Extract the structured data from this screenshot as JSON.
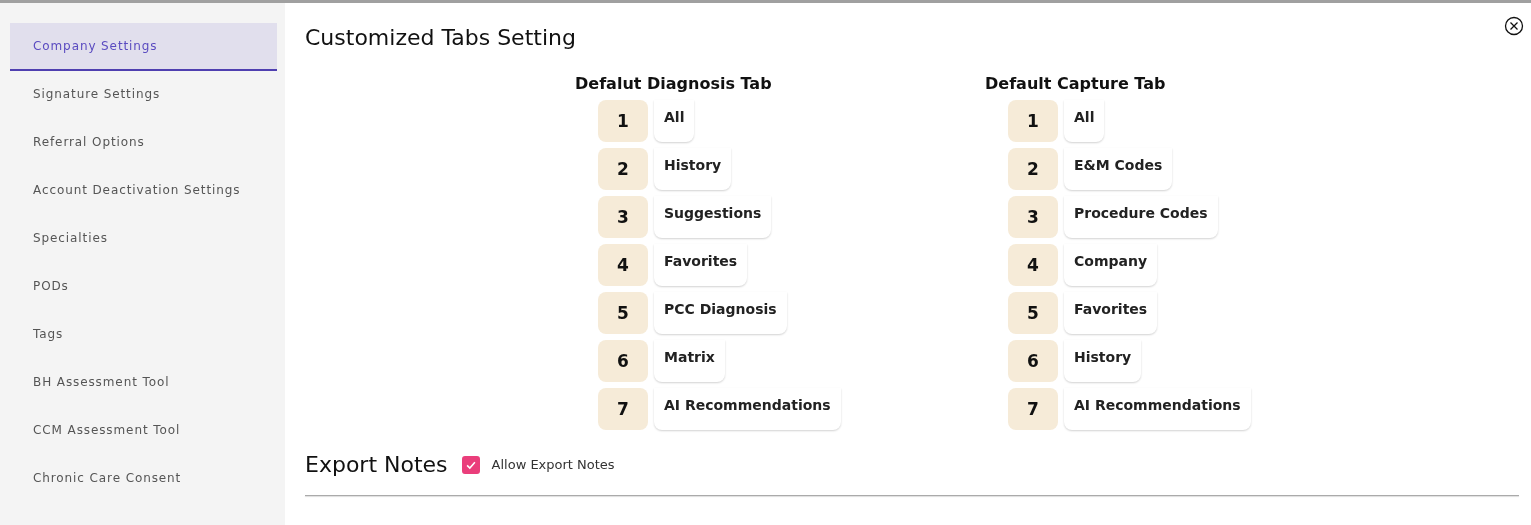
{
  "sidebar": {
    "items": [
      {
        "label": "Company Settings",
        "selected": true
      },
      {
        "label": "Signature Settings",
        "selected": false
      },
      {
        "label": "Referral Options",
        "selected": false
      },
      {
        "label": "Account Deactivation Settings",
        "selected": false
      },
      {
        "label": "Specialties",
        "selected": false
      },
      {
        "label": "PODs",
        "selected": false
      },
      {
        "label": "Tags",
        "selected": false
      },
      {
        "label": "BH Assessment Tool",
        "selected": false
      },
      {
        "label": "CCM Assessment Tool",
        "selected": false
      },
      {
        "label": "Chronic Care Consent",
        "selected": false
      }
    ]
  },
  "title": "Customized Tabs Setting",
  "tab_lists": [
    {
      "heading": "Defalut Diagnosis Tab",
      "tabs": [
        {
          "number": "1",
          "label": "All"
        },
        {
          "number": "2",
          "label": "History"
        },
        {
          "number": "3",
          "label": "Suggestions"
        },
        {
          "number": "4",
          "label": "Favorites"
        },
        {
          "number": "5",
          "label": "PCC Diagnosis"
        },
        {
          "number": "6",
          "label": "Matrix"
        },
        {
          "number": "7",
          "label": "AI Recommendations"
        }
      ]
    },
    {
      "heading": "Default Capture Tab",
      "tabs": [
        {
          "number": "1",
          "label": "All"
        },
        {
          "number": "2",
          "label": "E&M Codes"
        },
        {
          "number": "3",
          "label": "Procedure Codes"
        },
        {
          "number": "4",
          "label": "Company"
        },
        {
          "number": "5",
          "label": "Favorites"
        },
        {
          "number": "6",
          "label": "History"
        },
        {
          "number": "7",
          "label": "AI Recommendations"
        }
      ]
    }
  ],
  "export_notes": {
    "heading": "Export Notes",
    "checkbox": {
      "label": "Allow Export Notes",
      "checked": true
    }
  }
}
